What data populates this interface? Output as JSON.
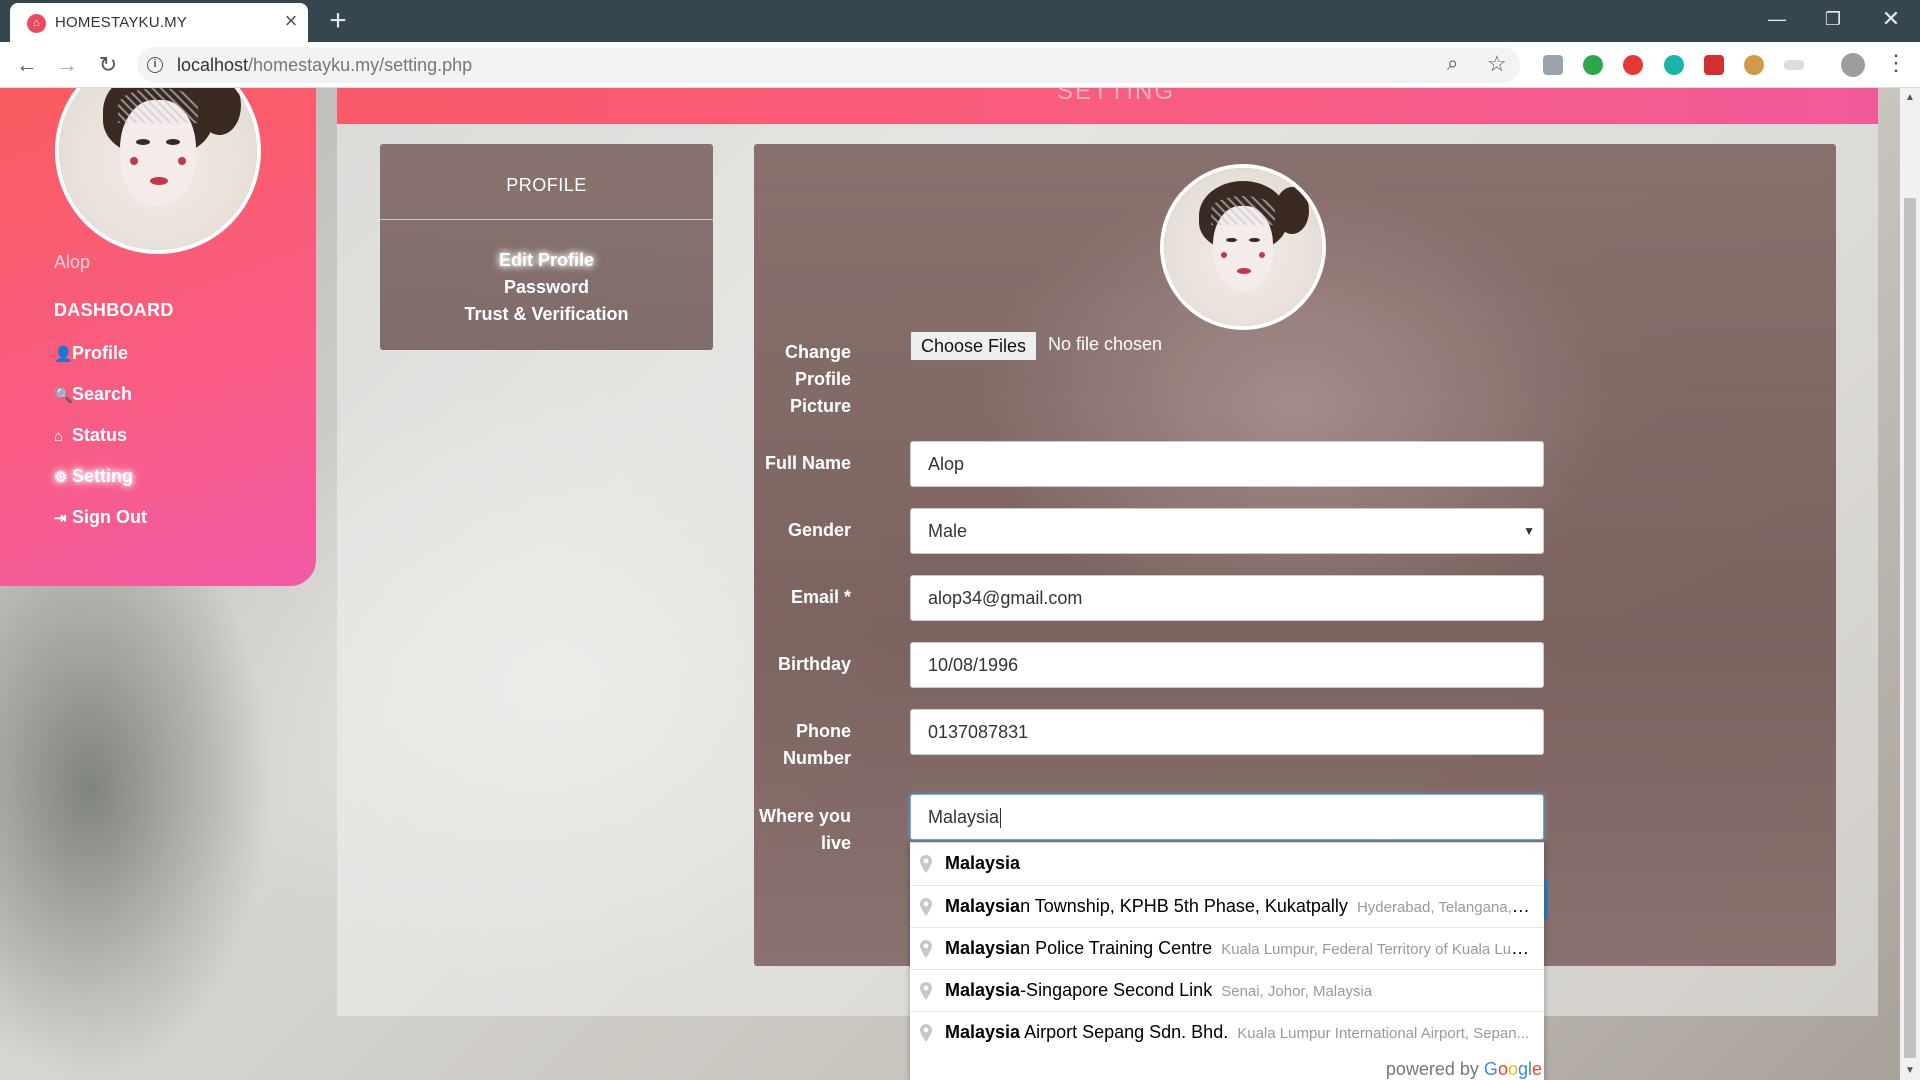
{
  "browser": {
    "tab_title": "HOMESTAYKU.MY",
    "url_host": "localhost",
    "url_path": "/homestayku.my/setting.php",
    "accent": "#35464f"
  },
  "banner": {
    "text": "SETTING"
  },
  "sidebar": {
    "user_name": "Alop",
    "dashboard_label": "DASHBOARD",
    "links": [
      {
        "label": "Profile",
        "icon": "user-icon"
      },
      {
        "label": "Search",
        "icon": "search-icon"
      },
      {
        "label": "Status",
        "icon": "home-icon"
      },
      {
        "label": "Setting",
        "icon": "gear-icon",
        "active": true
      },
      {
        "label": "Sign Out",
        "icon": "sign-out-icon"
      }
    ],
    "gradient_colors": [
      "#fb5c60",
      "#f25aa6"
    ]
  },
  "profile_menu": {
    "title": "PROFILE",
    "items": [
      {
        "label": "Edit Profile",
        "active": true
      },
      {
        "label": "Password"
      },
      {
        "label": "Trust & Verification"
      }
    ]
  },
  "form": {
    "change_picture_label": "Change Profile Picture",
    "file_button_label": "Choose Files",
    "file_status": "No file chosen",
    "full_name_label": "Full Name",
    "full_name_value": "Alop",
    "gender_label": "Gender",
    "gender_value": "Male",
    "email_label": "Email *",
    "email_value": "alop34@gmail.com",
    "birthday_label": "Birthday",
    "birthday_value": "10/08/1996",
    "phone_label": "Phone Number",
    "phone_value": "0137087831",
    "location_label": "Where you live",
    "location_value": "Malaysia"
  },
  "autocomplete": {
    "items": [
      {
        "match": "Malaysia",
        "rest": "",
        "secondary": ""
      },
      {
        "match": "Malaysia",
        "rest": "n Township, KPHB 5th Phase, Kukatpally",
        "secondary": "Hyderabad, Telangana, I..."
      },
      {
        "match": "Malaysia",
        "rest": "n Police Training Centre",
        "secondary": "Kuala Lumpur, Federal Territory of Kuala Lum..."
      },
      {
        "match": "Malaysia",
        "rest": "-Singapore Second Link",
        "secondary": "Senai, Johor, Malaysia"
      },
      {
        "match": "Malaysia",
        "rest": " Airport Sepang Sdn. Bhd.",
        "secondary": "Kuala Lumpur International Airport, Sepan..."
      }
    ],
    "powered_by": "powered by",
    "logo": "Google"
  }
}
